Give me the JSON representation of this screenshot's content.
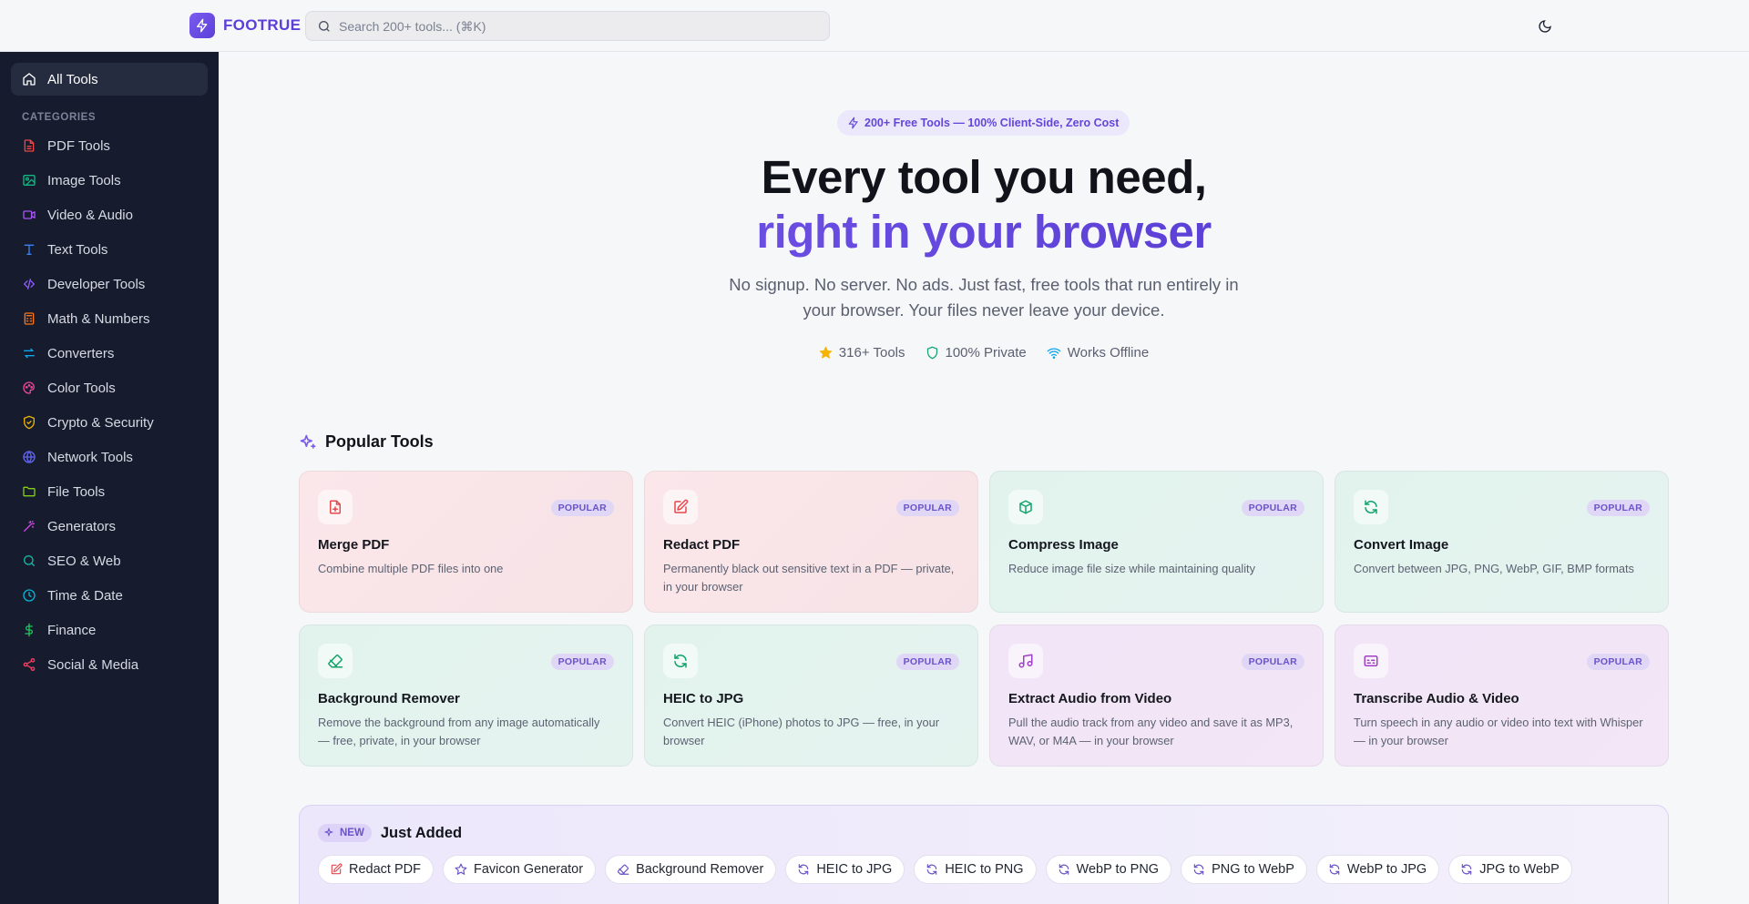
{
  "brand": {
    "name": "FOOTRUE"
  },
  "search": {
    "placeholder": "Search 200+ tools... (⌘K)"
  },
  "sidebar": {
    "all_tools": "All Tools",
    "categories_title": "CATEGORIES",
    "items": [
      {
        "label": "PDF Tools",
        "icon": "file-icon",
        "color": "#ef4444"
      },
      {
        "label": "Image Tools",
        "icon": "image-icon",
        "color": "#10b981"
      },
      {
        "label": "Video & Audio",
        "icon": "video-icon",
        "color": "#a855f7"
      },
      {
        "label": "Text Tools",
        "icon": "text-icon",
        "color": "#3b82f6"
      },
      {
        "label": "Developer Tools",
        "icon": "code-icon",
        "color": "#8b5cf6"
      },
      {
        "label": "Math & Numbers",
        "icon": "calculator-icon",
        "color": "#f97316"
      },
      {
        "label": "Converters",
        "icon": "arrows-icon",
        "color": "#0ea5e9"
      },
      {
        "label": "Color Tools",
        "icon": "palette-icon",
        "color": "#ec4899"
      },
      {
        "label": "Crypto & Security",
        "icon": "shield-icon",
        "color": "#eab308"
      },
      {
        "label": "Network Tools",
        "icon": "globe-icon",
        "color": "#6366f1"
      },
      {
        "label": "File Tools",
        "icon": "folder-icon",
        "color": "#84cc16"
      },
      {
        "label": "Generators",
        "icon": "wand-icon",
        "color": "#d946ef"
      },
      {
        "label": "SEO & Web",
        "icon": "search-icon",
        "color": "#14b8a6"
      },
      {
        "label": "Time & Date",
        "icon": "clock-icon",
        "color": "#06b6d4"
      },
      {
        "label": "Finance",
        "icon": "dollar-icon",
        "color": "#22c55e"
      },
      {
        "label": "Social & Media",
        "icon": "share-icon",
        "color": "#f43f5e"
      }
    ]
  },
  "hero": {
    "badge": "200+ Free Tools — 100% Client-Side, Zero Cost",
    "title_line1": "Every tool you need,",
    "title_line2": "right in your browser",
    "subtitle": "No signup. No server. No ads. Just fast, free tools that run entirely in your browser. Your files never leave your device.",
    "stats": [
      "316+ Tools",
      "100% Private",
      "Works Offline"
    ]
  },
  "popular": {
    "title": "Popular Tools",
    "badge": "POPULAR",
    "cards": [
      {
        "name": "Merge PDF",
        "desc": "Combine multiple PDF files into one",
        "tone": "red",
        "icon": "file-merge-icon",
        "color": "#e5484d"
      },
      {
        "name": "Redact PDF",
        "desc": "Permanently black out sensitive text in a PDF — private, in your browser",
        "tone": "red",
        "icon": "edit-icon",
        "color": "#e5484d"
      },
      {
        "name": "Compress Image",
        "desc": "Reduce image file size while maintaining quality",
        "tone": "green",
        "icon": "package-icon",
        "color": "#12a36b"
      },
      {
        "name": "Convert Image",
        "desc": "Convert between JPG, PNG, WebP, GIF, BMP formats",
        "tone": "green",
        "icon": "refresh-icon",
        "color": "#12a36b"
      },
      {
        "name": "Background Remover",
        "desc": "Remove the background from any image automatically — free, private, in your browser",
        "tone": "green",
        "icon": "eraser-icon",
        "color": "#12a36b"
      },
      {
        "name": "HEIC to JPG",
        "desc": "Convert HEIC (iPhone) photos to JPG — free, in your browser",
        "tone": "green",
        "icon": "refresh-icon",
        "color": "#12a36b"
      },
      {
        "name": "Extract Audio from Video",
        "desc": "Pull the audio track from any video and save it as MP3, WAV, or M4A — in your browser",
        "tone": "purple",
        "icon": "music-icon",
        "color": "#a23fc6"
      },
      {
        "name": "Transcribe Audio & Video",
        "desc": "Turn speech in any audio or video into text with Whisper — in your browser",
        "tone": "purple",
        "icon": "captions-icon",
        "color": "#a23fc6"
      }
    ]
  },
  "just_added": {
    "badge": "NEW",
    "title": "Just Added",
    "chips": [
      {
        "label": "Redact PDF",
        "icon": "edit-icon",
        "color": "#e5484d"
      },
      {
        "label": "Favicon Generator",
        "icon": "star-icon",
        "color": "#6a52c9"
      },
      {
        "label": "Background Remover",
        "icon": "eraser-icon",
        "color": "#6a52c9"
      },
      {
        "label": "HEIC to JPG",
        "icon": "refresh-icon",
        "color": "#6a52c9"
      },
      {
        "label": "HEIC to PNG",
        "icon": "refresh-icon",
        "color": "#6a52c9"
      },
      {
        "label": "WebP to PNG",
        "icon": "refresh-icon",
        "color": "#6a52c9"
      },
      {
        "label": "PNG to WebP",
        "icon": "refresh-icon",
        "color": "#6a52c9"
      },
      {
        "label": "WebP to JPG",
        "icon": "refresh-icon",
        "color": "#6a52c9"
      },
      {
        "label": "JPG to WebP",
        "icon": "refresh-icon",
        "color": "#6a52c9"
      }
    ]
  }
}
